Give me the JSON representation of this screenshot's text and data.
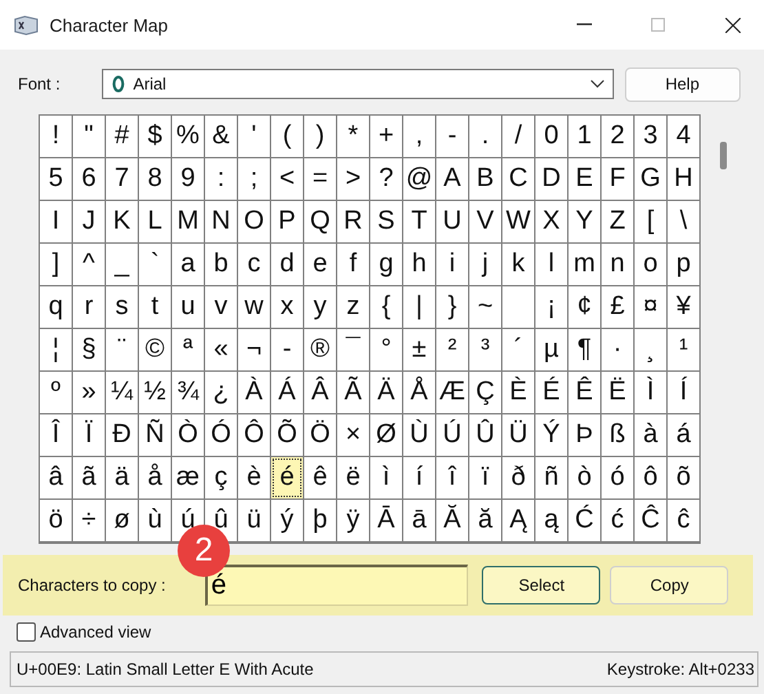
{
  "window": {
    "title": "Character Map"
  },
  "font": {
    "label": "Font :",
    "value": "Arial"
  },
  "help_button": "Help",
  "grid": [
    {
      "cells": [
        {
          "char": "!",
          "selected": false
        },
        {
          "char": "\"",
          "selected": false
        },
        {
          "char": "#",
          "selected": false
        },
        {
          "char": "$",
          "selected": false
        },
        {
          "char": "%",
          "selected": false
        },
        {
          "char": "&",
          "selected": false
        },
        {
          "char": "'",
          "selected": false
        },
        {
          "char": "(",
          "selected": false
        },
        {
          "char": ")",
          "selected": false
        },
        {
          "char": "*",
          "selected": false
        },
        {
          "char": "+",
          "selected": false
        },
        {
          "char": ",",
          "selected": false
        },
        {
          "char": "-",
          "selected": false
        },
        {
          "char": ".",
          "selected": false
        },
        {
          "char": "/",
          "selected": false
        },
        {
          "char": "0",
          "selected": false
        },
        {
          "char": "1",
          "selected": false
        },
        {
          "char": "2",
          "selected": false
        },
        {
          "char": "3",
          "selected": false
        },
        {
          "char": "4",
          "selected": false
        }
      ]
    },
    {
      "cells": [
        {
          "char": "5",
          "selected": false
        },
        {
          "char": "6",
          "selected": false
        },
        {
          "char": "7",
          "selected": false
        },
        {
          "char": "8",
          "selected": false
        },
        {
          "char": "9",
          "selected": false
        },
        {
          "char": ":",
          "selected": false
        },
        {
          "char": ";",
          "selected": false
        },
        {
          "char": "<",
          "selected": false
        },
        {
          "char": "=",
          "selected": false
        },
        {
          "char": ">",
          "selected": false
        },
        {
          "char": "?",
          "selected": false
        },
        {
          "char": "@",
          "selected": false
        },
        {
          "char": "A",
          "selected": false
        },
        {
          "char": "B",
          "selected": false
        },
        {
          "char": "C",
          "selected": false
        },
        {
          "char": "D",
          "selected": false
        },
        {
          "char": "E",
          "selected": false
        },
        {
          "char": "F",
          "selected": false
        },
        {
          "char": "G",
          "selected": false
        },
        {
          "char": "H",
          "selected": false
        }
      ]
    },
    {
      "cells": [
        {
          "char": "I",
          "selected": false
        },
        {
          "char": "J",
          "selected": false
        },
        {
          "char": "K",
          "selected": false
        },
        {
          "char": "L",
          "selected": false
        },
        {
          "char": "M",
          "selected": false
        },
        {
          "char": "N",
          "selected": false
        },
        {
          "char": "O",
          "selected": false
        },
        {
          "char": "P",
          "selected": false
        },
        {
          "char": "Q",
          "selected": false
        },
        {
          "char": "R",
          "selected": false
        },
        {
          "char": "S",
          "selected": false
        },
        {
          "char": "T",
          "selected": false
        },
        {
          "char": "U",
          "selected": false
        },
        {
          "char": "V",
          "selected": false
        },
        {
          "char": "W",
          "selected": false
        },
        {
          "char": "X",
          "selected": false
        },
        {
          "char": "Y",
          "selected": false
        },
        {
          "char": "Z",
          "selected": false
        },
        {
          "char": "[",
          "selected": false
        },
        {
          "char": "\\",
          "selected": false
        }
      ]
    },
    {
      "cells": [
        {
          "char": "]",
          "selected": false
        },
        {
          "char": "^",
          "selected": false
        },
        {
          "char": "_",
          "selected": false
        },
        {
          "char": "`",
          "selected": false
        },
        {
          "char": "a",
          "selected": false
        },
        {
          "char": "b",
          "selected": false
        },
        {
          "char": "c",
          "selected": false
        },
        {
          "char": "d",
          "selected": false
        },
        {
          "char": "e",
          "selected": false
        },
        {
          "char": "f",
          "selected": false
        },
        {
          "char": "g",
          "selected": false
        },
        {
          "char": "h",
          "selected": false
        },
        {
          "char": "i",
          "selected": false
        },
        {
          "char": "j",
          "selected": false
        },
        {
          "char": "k",
          "selected": false
        },
        {
          "char": "l",
          "selected": false
        },
        {
          "char": "m",
          "selected": false
        },
        {
          "char": "n",
          "selected": false
        },
        {
          "char": "o",
          "selected": false
        },
        {
          "char": "p",
          "selected": false
        }
      ]
    },
    {
      "cells": [
        {
          "char": "q",
          "selected": false
        },
        {
          "char": "r",
          "selected": false
        },
        {
          "char": "s",
          "selected": false
        },
        {
          "char": "t",
          "selected": false
        },
        {
          "char": "u",
          "selected": false
        },
        {
          "char": "v",
          "selected": false
        },
        {
          "char": "w",
          "selected": false
        },
        {
          "char": "x",
          "selected": false
        },
        {
          "char": "y",
          "selected": false
        },
        {
          "char": "z",
          "selected": false
        },
        {
          "char": "{",
          "selected": false
        },
        {
          "char": "|",
          "selected": false
        },
        {
          "char": "}",
          "selected": false
        },
        {
          "char": "~",
          "selected": false
        },
        {
          "selected": false
        },
        {
          "char": "¡",
          "selected": false
        },
        {
          "char": "¢",
          "selected": false
        },
        {
          "char": "£",
          "selected": false
        },
        {
          "char": "¤",
          "selected": false
        },
        {
          "char": "¥",
          "selected": false
        }
      ]
    },
    {
      "cells": [
        {
          "char": "¦",
          "selected": false
        },
        {
          "char": "§",
          "selected": false
        },
        {
          "char": "¨",
          "selected": false
        },
        {
          "char": "©",
          "selected": false
        },
        {
          "char": "ª",
          "selected": false
        },
        {
          "char": "«",
          "selected": false
        },
        {
          "char": "¬",
          "selected": false
        },
        {
          "char": "-",
          "selected": false
        },
        {
          "char": "®",
          "selected": false
        },
        {
          "char": "¯",
          "selected": false
        },
        {
          "char": "°",
          "selected": false
        },
        {
          "char": "±",
          "selected": false
        },
        {
          "char": "²",
          "selected": false
        },
        {
          "char": "³",
          "selected": false
        },
        {
          "char": "´",
          "selected": false
        },
        {
          "char": "µ",
          "selected": false
        },
        {
          "char": "¶",
          "selected": false
        },
        {
          "char": "·",
          "selected": false
        },
        {
          "char": "¸",
          "selected": false
        },
        {
          "char": "¹",
          "selected": false
        }
      ]
    },
    {
      "cells": [
        {
          "char": "º",
          "selected": false
        },
        {
          "char": "»",
          "selected": false
        },
        {
          "char": "¼",
          "selected": false
        },
        {
          "char": "½",
          "selected": false
        },
        {
          "char": "¾",
          "selected": false
        },
        {
          "char": "¿",
          "selected": false
        },
        {
          "char": "À",
          "selected": false
        },
        {
          "char": "Á",
          "selected": false
        },
        {
          "char": "Â",
          "selected": false
        },
        {
          "char": "Ã",
          "selected": false
        },
        {
          "char": "Ä",
          "selected": false
        },
        {
          "char": "Å",
          "selected": false
        },
        {
          "char": "Æ",
          "selected": false
        },
        {
          "char": "Ç",
          "selected": false
        },
        {
          "char": "È",
          "selected": false
        },
        {
          "char": "É",
          "selected": false
        },
        {
          "char": "Ê",
          "selected": false
        },
        {
          "char": "Ë",
          "selected": false
        },
        {
          "char": "Ì",
          "selected": false
        },
        {
          "char": "Í",
          "selected": false
        }
      ]
    },
    {
      "cells": [
        {
          "char": "Î",
          "selected": false
        },
        {
          "char": "Ï",
          "selected": false
        },
        {
          "char": "Ð",
          "selected": false
        },
        {
          "char": "Ñ",
          "selected": false
        },
        {
          "char": "Ò",
          "selected": false
        },
        {
          "char": "Ó",
          "selected": false
        },
        {
          "char": "Ô",
          "selected": false
        },
        {
          "char": "Õ",
          "selected": false
        },
        {
          "char": "Ö",
          "selected": false
        },
        {
          "char": "×",
          "selected": false
        },
        {
          "char": "Ø",
          "selected": false
        },
        {
          "char": "Ù",
          "selected": false
        },
        {
          "char": "Ú",
          "selected": false
        },
        {
          "char": "Û",
          "selected": false
        },
        {
          "char": "Ü",
          "selected": false
        },
        {
          "char": "Ý",
          "selected": false
        },
        {
          "char": "Þ",
          "selected": false
        },
        {
          "char": "ß",
          "selected": false
        },
        {
          "char": "à",
          "selected": false
        },
        {
          "char": "á",
          "selected": false
        }
      ]
    },
    {
      "cells": [
        {
          "char": "â",
          "selected": false
        },
        {
          "char": "ã",
          "selected": false
        },
        {
          "char": "ä",
          "selected": false
        },
        {
          "char": "å",
          "selected": false
        },
        {
          "char": "æ",
          "selected": false
        },
        {
          "char": "ç",
          "selected": false
        },
        {
          "char": "è",
          "selected": false
        },
        {
          "char": "é",
          "selected": true
        },
        {
          "char": "ê",
          "selected": false
        },
        {
          "char": "ë",
          "selected": false
        },
        {
          "char": "ì",
          "selected": false
        },
        {
          "char": "í",
          "selected": false
        },
        {
          "char": "î",
          "selected": false
        },
        {
          "char": "ï",
          "selected": false
        },
        {
          "char": "ð",
          "selected": false
        },
        {
          "char": "ñ",
          "selected": false
        },
        {
          "char": "ò",
          "selected": false
        },
        {
          "char": "ó",
          "selected": false
        },
        {
          "char": "ô",
          "selected": false
        },
        {
          "char": "õ",
          "selected": false
        }
      ]
    },
    {
      "cells": [
        {
          "char": "ö",
          "selected": false
        },
        {
          "char": "÷",
          "selected": false
        },
        {
          "char": "ø",
          "selected": false
        },
        {
          "char": "ù",
          "selected": false
        },
        {
          "char": "ú",
          "selected": false
        },
        {
          "char": "û",
          "selected": false
        },
        {
          "char": "ü",
          "selected": false
        },
        {
          "char": "ý",
          "selected": false
        },
        {
          "char": "þ",
          "selected": false
        },
        {
          "char": "ÿ",
          "selected": false
        },
        {
          "char": "Ā",
          "selected": false
        },
        {
          "char": "ā",
          "selected": false
        },
        {
          "char": "Ă",
          "selected": false
        },
        {
          "char": "ă",
          "selected": false
        },
        {
          "char": "Ą",
          "selected": false
        },
        {
          "char": "ą",
          "selected": false
        },
        {
          "char": "Ć",
          "selected": false
        },
        {
          "char": "ć",
          "selected": false
        },
        {
          "char": "Ĉ",
          "selected": false
        },
        {
          "char": "ĉ",
          "selected": false
        }
      ]
    }
  ],
  "copy": {
    "label": "Characters to copy :",
    "value": "é",
    "badge": "2"
  },
  "buttons": [
    "Select",
    "Copy"
  ],
  "advanced_view": {
    "label": "Advanced view",
    "checked": false
  },
  "status_bar": {
    "description": "U+00E9: Latin Small Letter E With Acute",
    "keystroke": "Keystroke: Alt+0233"
  }
}
